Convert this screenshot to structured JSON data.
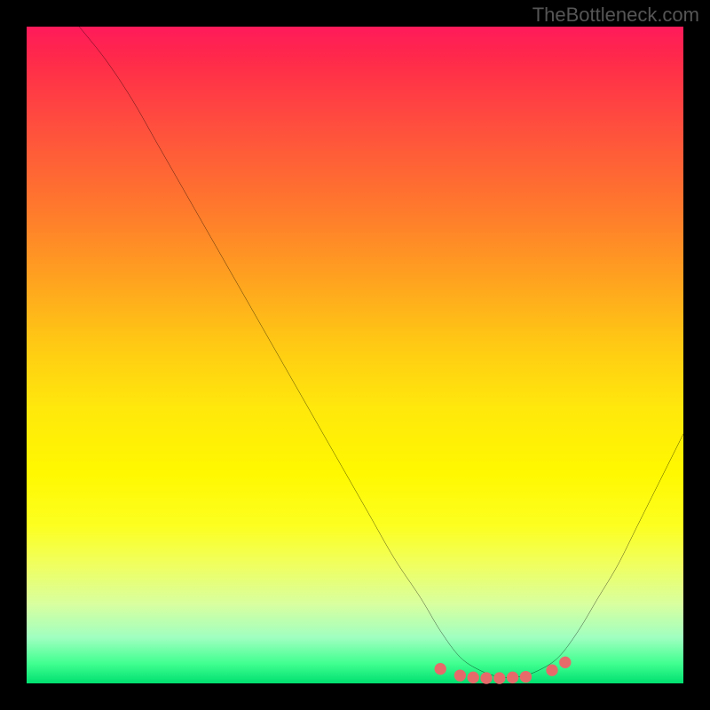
{
  "watermark": "TheBottleneck.com",
  "chart_data": {
    "type": "line",
    "title": "",
    "xlabel": "",
    "ylabel": "",
    "xlim": [
      0,
      100
    ],
    "ylim": [
      0,
      100
    ],
    "series": [
      {
        "name": "bottleneck-curve",
        "x": [
          8,
          12,
          16,
          20,
          24,
          28,
          32,
          36,
          40,
          44,
          48,
          52,
          56,
          60,
          63,
          66,
          69,
          72,
          75,
          78,
          81,
          84,
          87,
          90,
          93,
          96,
          100
        ],
        "values": [
          100,
          95,
          89,
          82,
          75,
          68,
          61,
          54,
          47,
          40,
          33,
          26,
          19,
          13,
          8,
          4,
          2,
          1,
          1,
          2,
          4,
          8,
          13,
          18,
          24,
          30,
          38
        ]
      }
    ],
    "markers": {
      "name": "highlight-dots",
      "color": "#e66a6a",
      "x": [
        63,
        66,
        68,
        70,
        72,
        74,
        76,
        80,
        82
      ],
      "values": [
        2.2,
        1.2,
        0.9,
        0.8,
        0.8,
        0.9,
        1.0,
        2.0,
        3.2
      ]
    },
    "gradient_meaning": "red (top) = high bottleneck, green (bottom) = low bottleneck"
  }
}
